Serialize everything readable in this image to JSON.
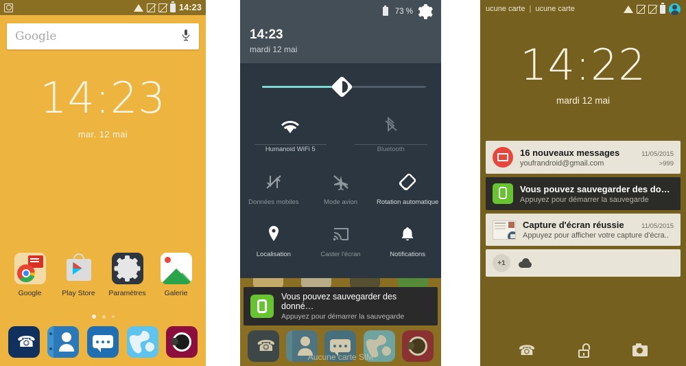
{
  "panels": {
    "home": {
      "statusbar": {
        "app_icon": "camera-icon",
        "wifi_icon": "wifi-icon",
        "sim1_icon": "no-sim-icon",
        "sim2_icon": "no-sim-icon",
        "battery_icon": "battery-icon",
        "clock": "14:23"
      },
      "search": {
        "placeholder": "Google",
        "mic_icon": "microphone-icon"
      },
      "clock": {
        "time": "14:23",
        "date": "mar. 12 mai"
      },
      "apps": [
        {
          "label": "Google",
          "icon": "google-folder-icon"
        },
        {
          "label": "Play Store",
          "icon": "play-store-icon"
        },
        {
          "label": "Paramètres",
          "icon": "settings-gear-icon"
        },
        {
          "label": "Galerie",
          "icon": "gallery-icon"
        }
      ],
      "page_dots": 3,
      "dock": [
        {
          "name": "phone",
          "icon": "phone-icon"
        },
        {
          "name": "contacts",
          "icon": "contacts-icon"
        },
        {
          "name": "messaging",
          "icon": "message-bubble-icon"
        },
        {
          "name": "browser",
          "icon": "globe-icon"
        },
        {
          "name": "camera",
          "icon": "camera-lens-icon"
        }
      ]
    },
    "quicksettings": {
      "header": {
        "battery_icon": "battery-icon",
        "battery_level": "73 %",
        "settings_icon": "gear-icon",
        "time": "14:23",
        "date": "mardi 12 mai"
      },
      "brightness": {
        "icon": "brightness-icon",
        "value_percent": 46
      },
      "toggles_top": [
        {
          "label": "Humanoid WiFi 5",
          "icon": "wifi-icon",
          "state": "on"
        },
        {
          "label": "Bluetooth",
          "icon": "bluetooth-off-icon",
          "state": "off"
        }
      ],
      "toggles_grid": [
        {
          "label": "Données mobiles",
          "icon": "mobile-data-off-icon",
          "state": "off"
        },
        {
          "label": "Mode avion",
          "icon": "airplane-off-icon",
          "state": "off"
        },
        {
          "label": "Rotation automatique",
          "icon": "auto-rotate-icon",
          "state": "on"
        },
        {
          "label": "Localisation",
          "icon": "location-pin-icon",
          "state": "on"
        },
        {
          "label": "Caster l'écran",
          "icon": "cast-screen-icon",
          "state": "off"
        },
        {
          "label": "Notifications",
          "icon": "bell-icon",
          "state": "on"
        }
      ],
      "notification": {
        "icon": "backup-icon",
        "title": "Vous pouvez sauvegarder des donné…",
        "subtitle": "Appuyez pour démarrer la sauvegarde"
      },
      "sim_text": "Aucune carte SIM"
    },
    "lockscreen": {
      "statusbar": {
        "carrier1": "ucune carte",
        "separator": "|",
        "carrier2": "ucune carte",
        "wifi_icon": "wifi-icon",
        "sim1_icon": "no-sim-icon",
        "sim2_icon": "no-sim-icon",
        "battery_icon": "battery-icon",
        "avatar_icon": "user-avatar-icon"
      },
      "clock": {
        "time": "14:22",
        "date": "mardi 12 mai"
      },
      "notifications": [
        {
          "icon": "gmail-icon",
          "title": "16 nouveaux messages",
          "subtitle": "youfrandroid@gmail.com",
          "date": "11/05/2015",
          "count": ">999",
          "style": "light"
        },
        {
          "icon": "backup-icon",
          "title": "Vous pouvez sauvegarder des donné…",
          "subtitle": "Appuyez pour démarrer la sauvegarde",
          "date": "",
          "count": "",
          "style": "dark"
        },
        {
          "icon": "screenshot-icon",
          "title": "Capture d'écran réussie",
          "subtitle": "Appuyez pour afficher votre capture d'écra..",
          "date": "11/05/2015",
          "count": "",
          "style": "light"
        }
      ],
      "more_row": {
        "badge": "+1",
        "icon": "cloud-upload-icon"
      },
      "shortcuts": [
        {
          "name": "phone-shortcut",
          "icon": "phone-icon"
        },
        {
          "name": "unlock",
          "icon": "unlocked-padlock-icon"
        },
        {
          "name": "camera-shortcut",
          "icon": "camera-icon"
        }
      ]
    }
  },
  "colors": {
    "home_bg": "#eeb440",
    "status_bar": "#8a6f22",
    "qs_header": "#444e57",
    "qs_body": "#2b3640",
    "lock_bg": "#76601f",
    "accent_slider": "#7fd8d2",
    "notif_light": "#e8e4d8",
    "notif_dark": "#2b2b27",
    "backup_green": "#67c330",
    "gmail_red": "#e8453c"
  }
}
